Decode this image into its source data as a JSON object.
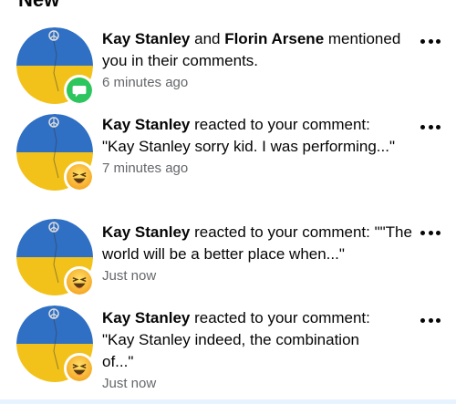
{
  "section": {
    "title": "New"
  },
  "notifications": [
    {
      "name1": "Kay Stanley",
      "joiner": " and ",
      "name2": "Florin Arsene",
      "action": " mentioned you in their comments.",
      "time": "6 minutes ago",
      "badge": "comment-icon"
    },
    {
      "name1": "Kay Stanley",
      "action": " reacted to your comment: \"Kay Stanley sorry kid. I was performing...\"",
      "time": "7 minutes ago",
      "badge": "haha-reaction-icon"
    },
    {
      "name1": "Kay Stanley",
      "action": " reacted to your comment: \"\"The world will be a better place when...\"",
      "time": "Just now",
      "badge": "haha-reaction-icon"
    },
    {
      "name1": "Kay Stanley",
      "action": " reacted to your comment: \"Kay Stanley indeed, the combination of...\"",
      "time": "Just now",
      "badge": "haha-reaction-icon"
    }
  ],
  "colors": {
    "flag_blue": "#2f6fc4",
    "flag_yellow": "#f2c21b",
    "comment_badge": "#2dc55e",
    "haha_badge": "#f7b125"
  }
}
